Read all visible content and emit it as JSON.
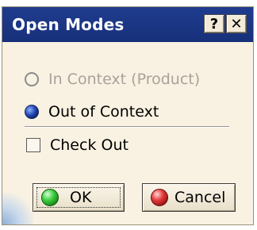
{
  "window": {
    "title": "Open Modes",
    "help_label": "?",
    "close_label": "✕"
  },
  "options": {
    "in_context": {
      "label": "In Context (Product)",
      "checked": false,
      "enabled": false
    },
    "out_of_context": {
      "label": "Out of Context",
      "checked": true,
      "enabled": true
    }
  },
  "check_out": {
    "label": "Check Out",
    "checked": false
  },
  "buttons": {
    "ok_label": "OK",
    "cancel_label": "Cancel"
  },
  "icons": {
    "ok": "green-ball-icon",
    "cancel": "red-ball-icon"
  }
}
